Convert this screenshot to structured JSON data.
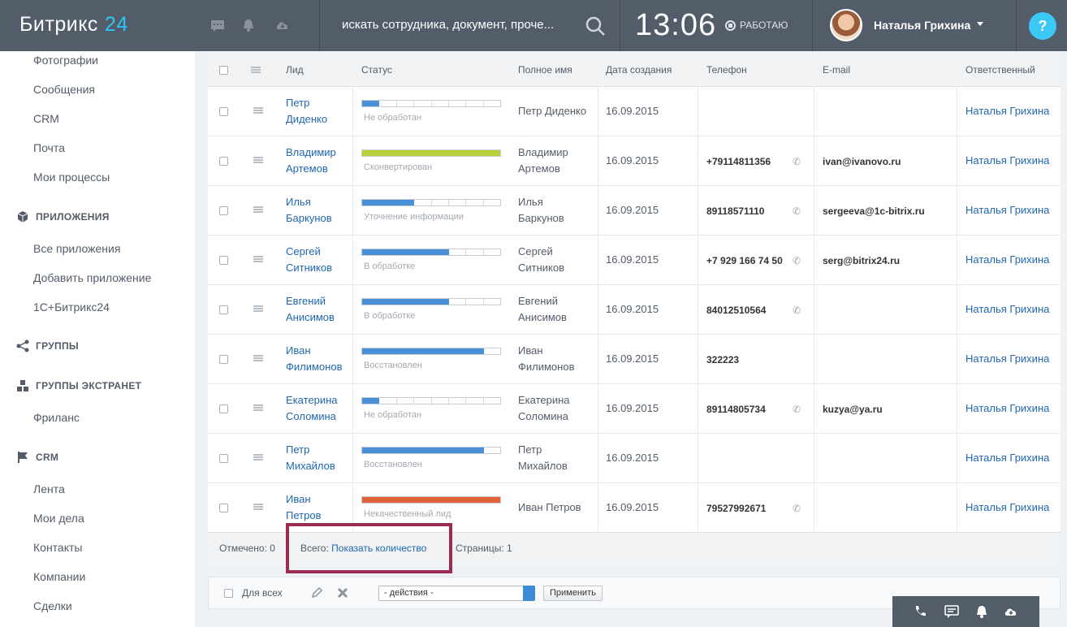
{
  "header": {
    "logo": "Битрикс",
    "logo_num": "24",
    "search_placeholder": "искать сотрудника, документ, проче...",
    "clock": "13:06",
    "work_status": "РАБОТАЮ",
    "user_name": "Наталья Грихина",
    "help_label": "?"
  },
  "sidebar": {
    "items_top": [
      "Фотографии",
      "Сообщения",
      "CRM",
      "Почта",
      "Мои процессы"
    ],
    "group_apps": "ПРИЛОЖЕНИЯ",
    "apps_items": [
      "Все приложения",
      "Добавить приложение",
      "1С+Битрикс24"
    ],
    "group_groups": "ГРУППЫ",
    "group_extranet": "ГРУППЫ ЭКСТРАНЕТ",
    "extranet_items": [
      "Фриланс"
    ],
    "group_crm": "CRM",
    "crm_items": [
      "Лента",
      "Мои дела",
      "Контакты",
      "Компании",
      "Сделки"
    ]
  },
  "grid": {
    "columns": [
      "Лид",
      "Статус",
      "Полное имя",
      "Дата создания",
      "Телефон",
      "E-mail",
      "Ответственный"
    ],
    "rows": [
      {
        "lead1": "Петр",
        "lead2": "Диденко",
        "status": "Не обработан",
        "status_fill": 0.125,
        "status_color": "#4a90d9",
        "name1": "Петр Диденко",
        "name2": "",
        "date": "16.09.2015",
        "phone": "",
        "email": "",
        "resp": "Наталья Грихина"
      },
      {
        "lead1": "Владимир",
        "lead2": "Артемов",
        "status": "Сконвертирован",
        "status_fill": 1.0,
        "status_color": "#b8cf3c",
        "name1": "Владимир",
        "name2": "Артемов",
        "date": "16.09.2015",
        "phone": "+79114811356",
        "email": "ivan@ivanovo.ru",
        "resp": "Наталья Грихина"
      },
      {
        "lead1": "Илья",
        "lead2": "Баркунов",
        "status": "Уточнение информации",
        "status_fill": 0.375,
        "status_color": "#4a90d9",
        "name1": "Илья",
        "name2": "Баркунов",
        "date": "16.09.2015",
        "phone": "89118571110",
        "email": "sergeeva@1c-bitrix.ru",
        "resp": "Наталья Грихина"
      },
      {
        "lead1": "Сергей",
        "lead2": "Ситников",
        "status": "В обработке",
        "status_fill": 0.625,
        "status_color": "#4a90d9",
        "name1": "Сергей",
        "name2": "Ситников",
        "date": "16.09.2015",
        "phone": "+7 929 166 74 50",
        "email": "serg@bitrix24.ru",
        "resp": "Наталья Грихина"
      },
      {
        "lead1": "Евгений",
        "lead2": "Анисимов",
        "status": "В обработке",
        "status_fill": 0.625,
        "status_color": "#4a90d9",
        "name1": "Евгений",
        "name2": "Анисимов",
        "date": "16.09.2015",
        "phone": "84012510564",
        "email": "",
        "resp": "Наталья Грихина"
      },
      {
        "lead1": "Иван",
        "lead2": "Филимонов",
        "status": "Восстановлен",
        "status_fill": 0.875,
        "status_color": "#4a90d9",
        "name1": "Иван",
        "name2": "Филимонов",
        "date": "16.09.2015",
        "phone": "322223",
        "email": "",
        "resp": "Наталья Грихина"
      },
      {
        "lead1": "Екатерина",
        "lead2": "Соломина",
        "status": "Не обработан",
        "status_fill": 0.125,
        "status_color": "#4a90d9",
        "name1": "Екатерина",
        "name2": "Соломина",
        "date": "16.09.2015",
        "phone": "89114805734",
        "email": "kuzya@ya.ru",
        "resp": "Наталья Грихина"
      },
      {
        "lead1": "Петр",
        "lead2": "Михайлов",
        "status": "Восстановлен",
        "status_fill": 0.875,
        "status_color": "#4a90d9",
        "name1": "Петр",
        "name2": "Михайлов",
        "date": "16.09.2015",
        "phone": "",
        "email": "",
        "resp": "Наталья Грихина"
      },
      {
        "lead1": "Иван",
        "lead2": "Петров",
        "status": "Некачественный лид",
        "status_fill": 1.0,
        "status_color": "#e2623a",
        "name1": "Иван Петров",
        "name2": "",
        "date": "16.09.2015",
        "phone": "79527992671",
        "email": "",
        "resp": "Наталья Грихина"
      }
    ],
    "footer": {
      "selected": "Отмечено: 0",
      "total_label": "Всего:",
      "total_link": "Показать количество",
      "pages": "Страницы:  1"
    }
  },
  "actions": {
    "for_all": "Для всех",
    "select_value": "- действия -",
    "apply": "Применить"
  }
}
